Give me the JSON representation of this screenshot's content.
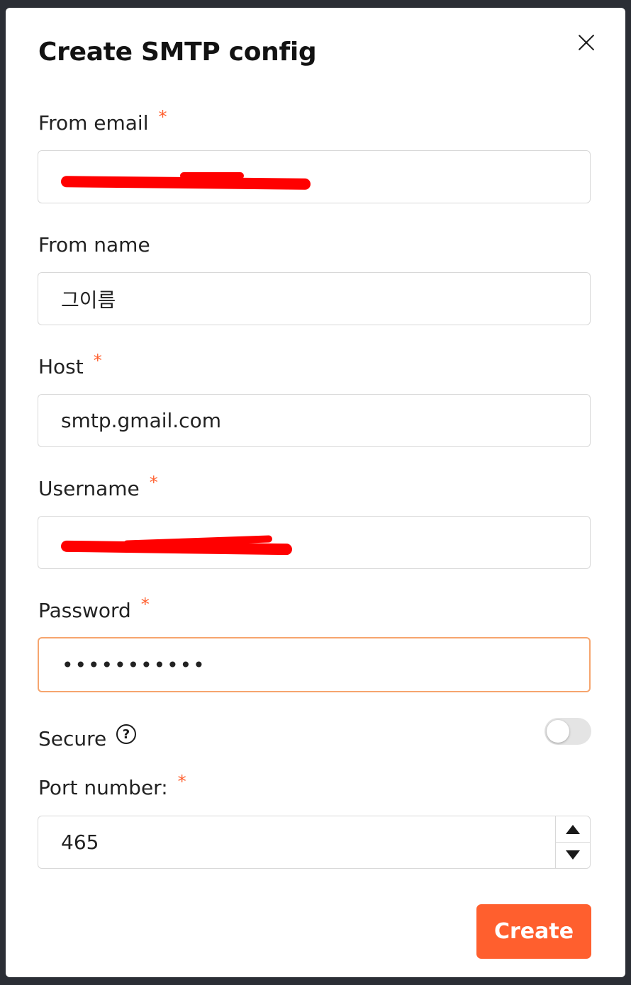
{
  "dialog": {
    "title": "Create SMTP config",
    "close_icon": "close-icon"
  },
  "fields": {
    "from_email": {
      "label": "From email",
      "required": "*",
      "value": ""
    },
    "from_name": {
      "label": "From name",
      "value": "그이름"
    },
    "host": {
      "label": "Host",
      "required": "*",
      "value": "smtp.gmail.com"
    },
    "username": {
      "label": "Username",
      "required": "*",
      "value": ""
    },
    "password": {
      "label": "Password",
      "required": "*",
      "value": "•••••••••••"
    },
    "secure": {
      "label": "Secure",
      "help_glyph": "?",
      "enabled": false
    },
    "port": {
      "label": "Port number:",
      "required": "*",
      "value": "465"
    }
  },
  "actions": {
    "create_label": "Create"
  },
  "colors": {
    "accent": "#ff5f2e",
    "focus_border": "#f6a56e",
    "redaction": "#ff0000"
  }
}
